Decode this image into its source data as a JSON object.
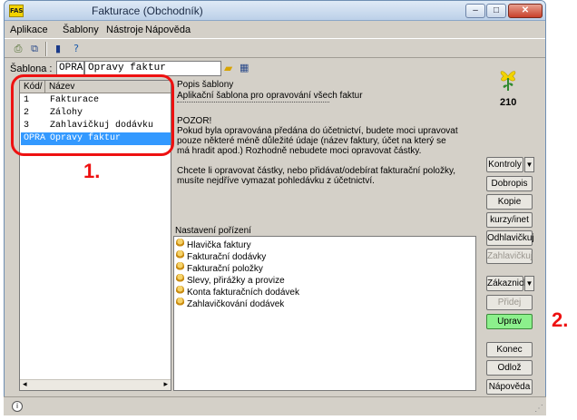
{
  "window": {
    "title": "Fakturace (Obchodník)",
    "logo": "FAS"
  },
  "title_buttons": {
    "minimize": "–",
    "maximize": "□",
    "close": "✕"
  },
  "menu": [
    {
      "label": "Aplikace"
    },
    {
      "label": "Šablony"
    },
    {
      "label": "Nástroje"
    },
    {
      "label": "Nápověda"
    }
  ],
  "toolbar": {
    "icons": [
      "print-icon",
      "copy-icon",
      "exit-door-icon",
      "help-icon"
    ]
  },
  "sablona": {
    "label": "Šablona :",
    "code": "OPRA",
    "name": "Opravy faktur"
  },
  "list": {
    "headers": {
      "kod": "Kód/",
      "nazev": "Název"
    },
    "rows": [
      {
        "kod": "1",
        "nazev": "Fakturace"
      },
      {
        "kod": "2",
        "nazev": "Zálohy"
      },
      {
        "kod": "3",
        "nazev": "Zahlavičkuj dodávku"
      },
      {
        "kod": "OPRA",
        "nazev": "Opravy faktur"
      }
    ],
    "selected_index": 3
  },
  "description": {
    "title": "Popis šablony",
    "subtitle": "Aplikační šablona pro opravování všech faktur",
    "lines": [
      "POZOR!",
      "Pokud byla opravována předána do účetnictví, budete moci upravovat",
      "pouze některé méně důležité údaje (název faktury, účet na který se",
      "má hradit apod.) Rozhodně nebudete moci opravovat částky.",
      "",
      "Chcete li opravovat částky, nebo přidávat/odebírat fakturační položky,",
      "musíte nejdříve vymazat pohledávku z účetnictví."
    ]
  },
  "nastaveni": {
    "label": "Nastavení pořízení",
    "items": [
      "Hlavička faktury",
      "Fakturační dodávky",
      "Fakturační položky",
      "Slevy, přirážky a provize",
      "Konta fakturačních dodávek",
      "Zahlavičkování dodávek"
    ]
  },
  "right": {
    "number": "210",
    "buttons": {
      "kontroly": "Kontroly",
      "dobropis": "Dobropis",
      "kopie": "Kopie",
      "kurzy": "kurzy/inet",
      "odhlavickuj": "Odhlavičkuj",
      "zahlavickuj": "Zahlavičkuj",
      "zakaznicke": "Zákaznické",
      "pridej": "Přidej",
      "uprav": "Uprav",
      "konec": "Konec",
      "odloz": "Odlož",
      "napoveda": "Nápověda"
    }
  },
  "annotations": {
    "one": "1.",
    "two": "2."
  },
  "colors": {
    "selection": "#3399ff",
    "annotation": "#ee1111",
    "uprav_button": "#8cf08c"
  }
}
